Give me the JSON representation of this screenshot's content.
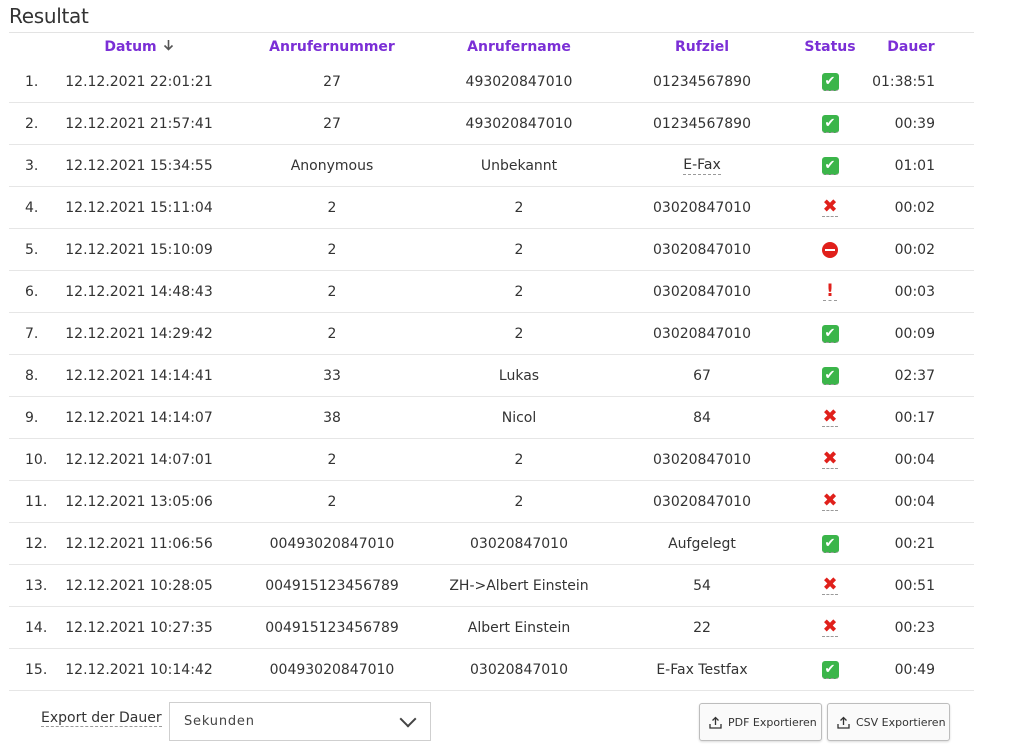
{
  "title": "Resultat",
  "columns": {
    "datum": "Datum",
    "anrufernummer": "Anrufernummer",
    "anrufername": "Anrufername",
    "rufziel": "Rufziel",
    "status": "Status",
    "dauer": "Dauer"
  },
  "sort": {
    "column": "Datum",
    "direction": "descending"
  },
  "rows": [
    {
      "idx": "1.",
      "datum": "12.12.2021 22:01:21",
      "nummer": "27",
      "name": "493020847010",
      "ziel": "01234567890",
      "status": "ok",
      "dauer": "01:38:51"
    },
    {
      "idx": "2.",
      "datum": "12.12.2021 21:57:41",
      "nummer": "27",
      "name": "493020847010",
      "ziel": "01234567890",
      "status": "ok",
      "dauer": "00:39"
    },
    {
      "idx": "3.",
      "datum": "12.12.2021 15:34:55",
      "nummer": "Anonymous",
      "name": "Unbekannt",
      "ziel": "E-Fax",
      "status": "ok",
      "dauer": "01:01"
    },
    {
      "idx": "4.",
      "datum": "12.12.2021 15:11:04",
      "nummer": "2",
      "name": "2",
      "ziel": "03020847010",
      "status": "failed",
      "dauer": "00:02"
    },
    {
      "idx": "5.",
      "datum": "12.12.2021 15:10:09",
      "nummer": "2",
      "name": "2",
      "ziel": "03020847010",
      "status": "blocked",
      "dauer": "00:02"
    },
    {
      "idx": "6.",
      "datum": "12.12.2021 14:48:43",
      "nummer": "2",
      "name": "2",
      "ziel": "03020847010",
      "status": "warning",
      "dauer": "00:03"
    },
    {
      "idx": "7.",
      "datum": "12.12.2021 14:29:42",
      "nummer": "2",
      "name": "2",
      "ziel": "03020847010",
      "status": "ok",
      "dauer": "00:09"
    },
    {
      "idx": "8.",
      "datum": "12.12.2021 14:14:41",
      "nummer": "33",
      "name": "Lukas",
      "ziel": "67",
      "status": "ok",
      "dauer": "02:37"
    },
    {
      "idx": "9.",
      "datum": "12.12.2021 14:14:07",
      "nummer": "38",
      "name": "Nicol",
      "ziel": "84",
      "status": "failed",
      "dauer": "00:17"
    },
    {
      "idx": "10.",
      "datum": "12.12.2021 14:07:01",
      "nummer": "2",
      "name": "2",
      "ziel": "03020847010",
      "status": "failed",
      "dauer": "00:04"
    },
    {
      "idx": "11.",
      "datum": "12.12.2021 13:05:06",
      "nummer": "2",
      "name": "2",
      "ziel": "03020847010",
      "status": "failed",
      "dauer": "00:04"
    },
    {
      "idx": "12.",
      "datum": "12.12.2021 11:06:56",
      "nummer": "00493020847010",
      "name": "03020847010",
      "ziel": "Aufgelegt",
      "status": "ok",
      "dauer": "00:21"
    },
    {
      "idx": "13.",
      "datum": "12.12.2021 10:28:05",
      "nummer": "004915123456789",
      "name": "ZH->Albert Einstein",
      "ziel": "54",
      "status": "failed",
      "dauer": "00:51"
    },
    {
      "idx": "14.",
      "datum": "12.12.2021 10:27:35",
      "nummer": "004915123456789",
      "name": "Albert Einstein",
      "ziel": "22",
      "status": "failed",
      "dauer": "00:23"
    },
    {
      "idx": "15.",
      "datum": "12.12.2021 10:14:42",
      "nummer": "00493020847010",
      "name": "03020847010",
      "ziel": "E-Fax Testfax",
      "status": "ok",
      "dauer": "00:49"
    }
  ],
  "footer": {
    "export_label": "Export der Dauer",
    "select_value": "Sekunden",
    "pdf_button": "PDF Exportieren",
    "csv_button": "CSV Exportieren"
  },
  "colors": {
    "header": "#7b2fd6",
    "ok": "#3bb54a",
    "error": "#e0201b"
  },
  "icons": {
    "ok": "check-icon",
    "failed": "cross-icon",
    "blocked": "no-entry-icon",
    "warning": "exclamation-icon",
    "sort": "arrow-down-icon",
    "export": "upload-icon",
    "select": "chevron-down-icon"
  }
}
